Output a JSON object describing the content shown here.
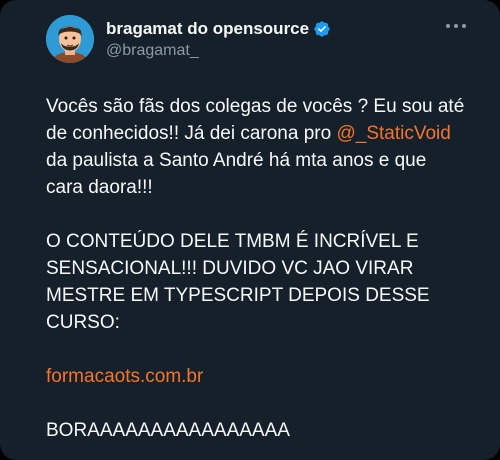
{
  "tweet": {
    "author_name": "bragamat do opensource",
    "author_handle": "@bragamat_",
    "paragraph1": {
      "text_before": "Vocês são fãs dos colegas de vocês ? Eu sou até de conhecidos!! Já dei carona pro ",
      "mention": "@_StaticVoid",
      "text_after": " da paulista a Santo André há mta anos e que cara daora!!!"
    },
    "paragraph2": "O CONTEÚDO DELE TMBM É INCRÍVEL E SENSACIONAL!!! DUVIDO VC JAO VIRAR MESTRE EM TYPESCRIPT DEPOIS DESSE CURSO:",
    "link": "formacaots.com.br",
    "paragraph3": "BORAAAAAAAAAAAAAAAA"
  },
  "icons": {
    "verified": "verified-badge-icon",
    "more": "more-options-icon",
    "avatar": "avatar-illustration"
  },
  "colors": {
    "background": "#15202b",
    "text": "#f7f9f9",
    "secondary_text": "#8b98a5",
    "link": "#f4752b",
    "verified": "#1d9bf0",
    "avatar_bg": "#2f9bd6"
  }
}
